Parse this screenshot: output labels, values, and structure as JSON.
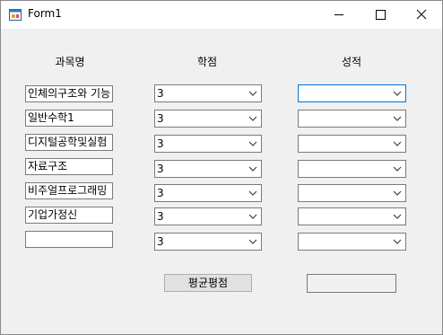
{
  "window": {
    "title": "Form1"
  },
  "headers": {
    "subject": "과목명",
    "credit": "학점",
    "grade": "성적"
  },
  "rows": [
    {
      "subject": "인체의구조와 기능",
      "credit": "3",
      "grade": ""
    },
    {
      "subject": "일반수학1",
      "credit": "3",
      "grade": ""
    },
    {
      "subject": "디지털공학및실험",
      "credit": "3",
      "grade": ""
    },
    {
      "subject": "자료구조",
      "credit": "3",
      "grade": ""
    },
    {
      "subject": "비주얼프로그래밍",
      "credit": "3",
      "grade": ""
    },
    {
      "subject": "기업가정신",
      "credit": "3",
      "grade": ""
    },
    {
      "subject": "",
      "credit": "3",
      "grade": ""
    }
  ],
  "average_button": {
    "label": "평균평점"
  },
  "result": {
    "value": ""
  },
  "icons": {
    "app": "form-icon",
    "minimize": "minimize-icon",
    "maximize": "maximize-icon",
    "close": "close-icon",
    "dropdown": "chevron-down-icon"
  }
}
